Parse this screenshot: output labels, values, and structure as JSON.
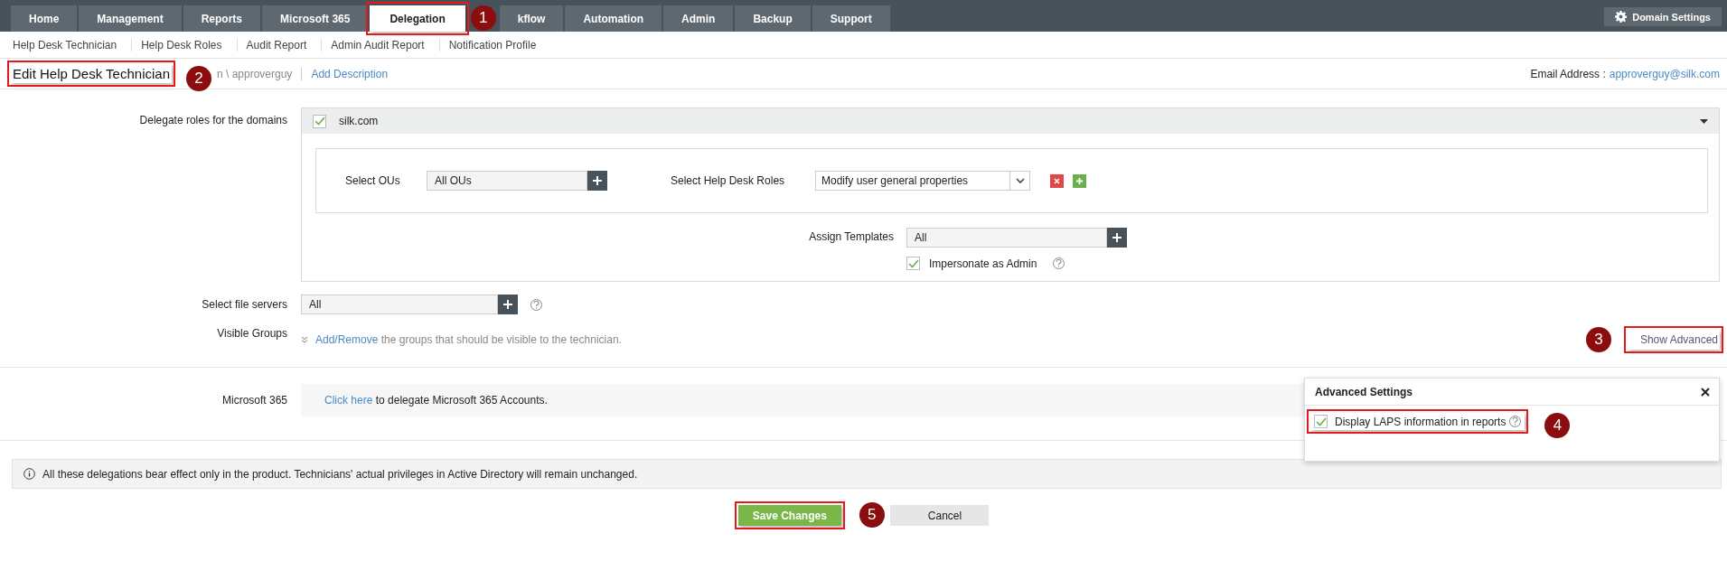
{
  "top_nav": {
    "tabs": [
      {
        "label": "Home",
        "selected": false,
        "highlighted": false
      },
      {
        "label": "Management",
        "selected": false,
        "highlighted": false
      },
      {
        "label": "Reports",
        "selected": false,
        "highlighted": false
      },
      {
        "label": "Microsoft 365",
        "selected": false,
        "highlighted": false
      },
      {
        "label": "Delegation",
        "selected": true,
        "highlighted": true,
        "marker": "1"
      },
      {
        "label": "kflow",
        "selected": false,
        "highlighted": false
      },
      {
        "label": "Automation",
        "selected": false,
        "highlighted": false
      },
      {
        "label": "Admin",
        "selected": false,
        "highlighted": false
      },
      {
        "label": "Backup",
        "selected": false,
        "highlighted": false
      },
      {
        "label": "Support",
        "selected": false,
        "highlighted": false
      }
    ],
    "domain_settings": "Domain Settings"
  },
  "sub_nav": [
    "Help Desk Technician",
    "Help Desk Roles",
    "Audit Report",
    "Admin Audit Report",
    "Notification Profile"
  ],
  "header": {
    "title": "Edit Help Desk Technician",
    "highlighted": true,
    "marker": "2",
    "breadcrumb": "n \\ approverguy",
    "add_description": "Add Description",
    "email_label": "Email Address :",
    "email": "approverguy@silk.com"
  },
  "domains": {
    "label": "Delegate roles for the domains",
    "domain": "silk.com",
    "checked": true,
    "ous_label": "Select OUs",
    "ous_value": "All OUs",
    "roles_label": "Select Help Desk Roles",
    "role_value": "Modify user general properties",
    "templates_label": "Assign Templates",
    "templates_value": "All",
    "impersonate_label": "Impersonate as Admin",
    "impersonate_checked": true
  },
  "file_servers": {
    "label": "Select file servers",
    "value": "All"
  },
  "visible_groups": {
    "label": "Visible Groups",
    "link": "Add/Remove",
    "text": "the groups that should be visible to the technician."
  },
  "show_advanced": {
    "label": "Show Advanced",
    "highlighted": true,
    "marker": "3"
  },
  "advanced_settings": {
    "title": "Advanced Settings",
    "option": {
      "label": "Display LAPS information in reports",
      "checked": true,
      "highlighted": true,
      "marker": "4"
    }
  },
  "microsoft365": {
    "label": "Microsoft 365",
    "link": "Click here",
    "text": "to delegate Microsoft 365 Accounts."
  },
  "info": "All these delegations bear effect only in the product. Technicians' actual privileges in Active Directory will remain unchanged.",
  "buttons": [
    {
      "label": "Save Changes",
      "kind": "primary",
      "highlighted": true,
      "marker": "5"
    },
    {
      "label": "Cancel",
      "kind": "secondary",
      "highlighted": false
    }
  ]
}
